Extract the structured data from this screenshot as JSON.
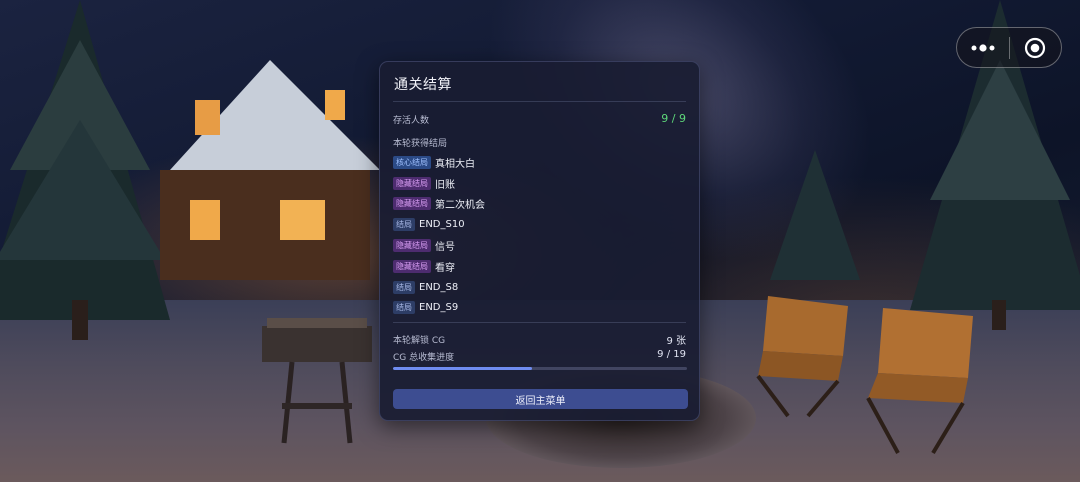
{
  "capsule": {
    "more_icon": "more-dots-icon",
    "close_icon": "target-circle-icon"
  },
  "panel": {
    "title": "通关结算",
    "survivors_label": "存活人数",
    "survivors_value": "9 / 9",
    "endings_label": "本轮获得结局",
    "endings": [
      {
        "tag": "核心结局",
        "tag_type": "core",
        "name": "真相大白"
      },
      {
        "tag": "隐藏结局",
        "tag_type": "hidden",
        "name": "旧账"
      },
      {
        "tag": "隐藏结局",
        "tag_type": "hidden",
        "name": "第二次机会"
      },
      {
        "tag": "结局",
        "tag_type": "normal",
        "name": "END_S10"
      },
      {
        "tag": "隐藏结局",
        "tag_type": "hidden",
        "name": "信号"
      },
      {
        "tag": "隐藏结局",
        "tag_type": "hidden",
        "name": "看穿"
      },
      {
        "tag": "结局",
        "tag_type": "normal",
        "name": "END_S8"
      },
      {
        "tag": "结局",
        "tag_type": "normal",
        "name": "END_S9"
      }
    ],
    "cg_unlocked_label": "本轮解锁 CG",
    "cg_unlocked_value": "9 张",
    "cg_progress_label": "CG 总收集进度",
    "cg_progress_value": "9 / 19",
    "cg_progress_fraction": 0.4737,
    "return_button": "返回主菜单"
  },
  "colors": {
    "accent": "#6f8cf0",
    "survivors": "#5ed87a",
    "button": "#3d4d91"
  }
}
